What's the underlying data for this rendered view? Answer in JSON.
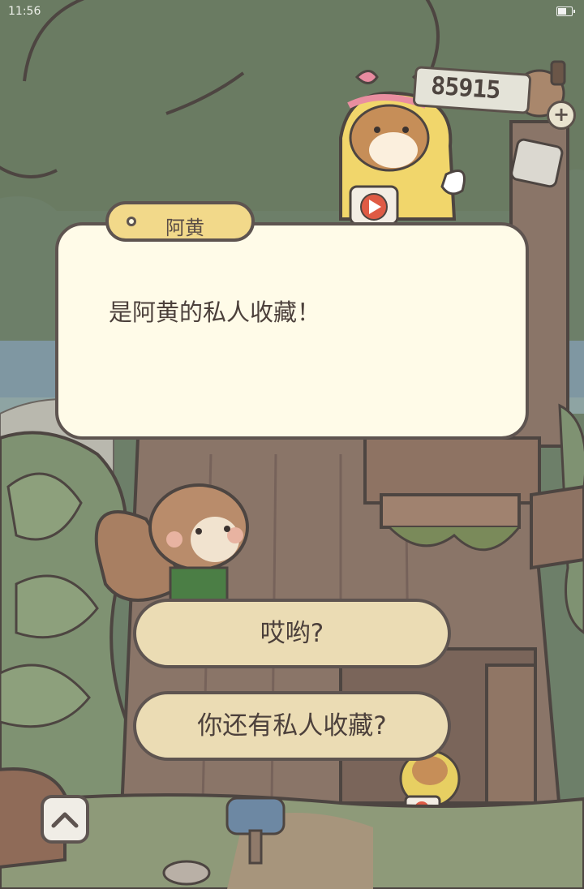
{
  "status_bar": {
    "time": "11:56"
  },
  "coins": {
    "amount": "85915"
  },
  "dialog": {
    "speaker": "阿黄",
    "text": "是阿黄的私人收藏！"
  },
  "choices": [
    {
      "label": "哎哟?"
    },
    {
      "label": "你还有私人收藏?"
    }
  ],
  "icons": [
    "battery-icon",
    "plus-icon",
    "chevron-up-icon",
    "tv-icon"
  ],
  "colors": {
    "dialog_bg": "#fffbe8",
    "name_tag_bg": "#f2d98a",
    "choice_bg": "#ebdcb4",
    "outline": "#5e5450",
    "forest": "#6f806a"
  }
}
